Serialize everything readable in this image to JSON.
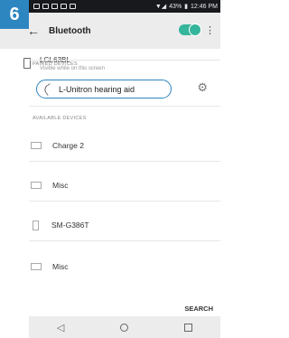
{
  "step": {
    "number": "6"
  },
  "status_bar": {
    "battery": "43%",
    "time": "12:46 PM"
  },
  "app_bar": {
    "title": "Bluetooth",
    "toggle_on": true
  },
  "own_device": {
    "name": "LGL63BL",
    "subtitle": "Visible while on this screen"
  },
  "sections": {
    "paired": "PAIRED DEVICES",
    "available": "AVAILABLE DEVICES"
  },
  "paired_devices": [
    {
      "name": "L-Unitron hearing aid"
    }
  ],
  "available_devices": [
    {
      "name": "Charge 2",
      "icon": "device-icon"
    },
    {
      "name": "Misc",
      "icon": "device-icon"
    },
    {
      "name": "SM-G386T",
      "icon": "phone-icon"
    },
    {
      "name": "Misc",
      "icon": "device-icon"
    }
  ],
  "actions": {
    "search": "SEARCH"
  },
  "colors": {
    "accent": "#2e86c1",
    "toggle": "#35b59b"
  }
}
